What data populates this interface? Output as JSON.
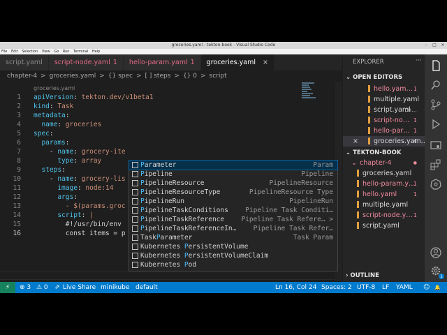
{
  "window": {
    "title": "groceries.yaml - tekton-book - Visual Studio Code"
  },
  "menu": [
    "File",
    "Edit",
    "Selection",
    "View",
    "Go",
    "Run",
    "Terminal",
    "Help"
  ],
  "tabs": [
    {
      "label": "script.yaml",
      "badge": "",
      "state": "normal"
    },
    {
      "label": "script-node.yaml",
      "badge": "1",
      "state": "dirty"
    },
    {
      "label": "hello-param.yaml",
      "badge": "1",
      "state": "dirty"
    },
    {
      "label": "groceries.yaml",
      "badge": "",
      "state": "active",
      "close": "×"
    }
  ],
  "breadcrumb": [
    "chapter-4",
    ">",
    "groceries.yaml",
    ">",
    "{} spec",
    ">",
    "[ ] steps",
    ">",
    "{} 0",
    ">",
    "script"
  ],
  "editor": {
    "header": "groceries.yaml",
    "lines": [
      {
        "n": "1",
        "key": "apiVersion",
        "sep": ": ",
        "val": "tekton.dev/v1beta1",
        "indent": ""
      },
      {
        "n": "2",
        "key": "kind",
        "sep": ": ",
        "val": "Task",
        "indent": ""
      },
      {
        "n": "3",
        "key": "metadata",
        "sep": ":",
        "val": "",
        "indent": ""
      },
      {
        "n": "4",
        "key": "name",
        "sep": ": ",
        "val": "groceries",
        "indent": "  "
      },
      {
        "n": "5",
        "key": "spec",
        "sep": ":",
        "val": "",
        "indent": ""
      },
      {
        "n": "6",
        "key": "params",
        "sep": ":",
        "val": "",
        "indent": "  "
      },
      {
        "n": "7",
        "key": "name",
        "sep": ": ",
        "val": "grocery-ite",
        "indent": "    - "
      },
      {
        "n": "8",
        "key": "type",
        "sep": ": ",
        "val": "array",
        "indent": "      "
      },
      {
        "n": "9",
        "key": "steps",
        "sep": ":",
        "val": "",
        "indent": "  "
      },
      {
        "n": "10",
        "key": "name",
        "sep": ": ",
        "val": "grocery-lis",
        "indent": "    - "
      },
      {
        "n": "11",
        "key": "image",
        "sep": ": ",
        "val": "node:14",
        "indent": "      "
      },
      {
        "n": "12",
        "key": "args",
        "sep": ":",
        "val": "",
        "indent": "      "
      },
      {
        "n": "13",
        "key": "",
        "sep": "",
        "val": "- $(params.groc",
        "indent": "        "
      },
      {
        "n": "14",
        "key": "script",
        "sep": ": ",
        "val": "|",
        "indent": "      "
      },
      {
        "n": "15",
        "key": "",
        "sep": "",
        "val": "#!/usr/bin/env",
        "indent": "        "
      },
      {
        "n": "16",
        "key": "",
        "sep": "",
        "val": "const items = p",
        "indent": "        "
      }
    ]
  },
  "suggestions": [
    {
      "pre": "",
      "match": "P",
      "rest": "arameter",
      "detail": "Param",
      "selected": true
    },
    {
      "pre": "",
      "match": "P",
      "rest": "ipeline",
      "detail": "Pipeline",
      "selected": false
    },
    {
      "pre": "",
      "match": "P",
      "rest": "ipelineResource",
      "detail": "PipelineResource",
      "selected": false
    },
    {
      "pre": "",
      "match": "P",
      "rest": "ipelineResourceType",
      "detail": "PipelineResource Type",
      "selected": false
    },
    {
      "pre": "",
      "match": "P",
      "rest": "ipelineRun",
      "detail": "PipelineRun",
      "selected": false
    },
    {
      "pre": "",
      "match": "P",
      "rest": "ipelineTaskConditions",
      "detail": "Pipeline Task Conditi…",
      "selected": false
    },
    {
      "pre": "",
      "match": "P",
      "rest": "ipelineTaskReference",
      "detail": "Pipeline Task Refere… >",
      "selected": false
    },
    {
      "pre": "",
      "match": "P",
      "rest": "ipelineTaskReferenceIn…",
      "detail": "Pipeline Task Refer…",
      "selected": false
    },
    {
      "pre": "Task",
      "match": "P",
      "rest": "arameter",
      "detail": "Task Param",
      "selected": false
    },
    {
      "pre": "Kubernetes ",
      "match": "P",
      "rest": "ersistentVolume",
      "detail": "",
      "selected": false
    },
    {
      "pre": "Kubernetes ",
      "match": "P",
      "rest": "ersistentVolumeClaim",
      "detail": "",
      "selected": false
    },
    {
      "pre": "Kubernetes ",
      "match": "P",
      "rest": "od",
      "detail": "",
      "selected": false
    }
  ],
  "sidebar": {
    "title": "EXPLORER",
    "more": "···",
    "open_editors_label": "OPEN EDITORS",
    "open_editors": [
      {
        "name": "hello.yam…",
        "count": "1",
        "color": "red"
      },
      {
        "name": "multiple.yaml",
        "count": "",
        "color": "white"
      },
      {
        "name": "script.yaml",
        "count": "ch…",
        "color": "white"
      },
      {
        "name": "script-no…",
        "count": "1",
        "color": "red"
      },
      {
        "name": "hello-par…",
        "count": "1",
        "color": "red"
      },
      {
        "name": "groceries.yam…",
        "count": "4",
        "color": "white",
        "close": "×"
      }
    ],
    "project_label": "TEKTON-BOOK",
    "folder": {
      "name": "chapter-4",
      "marker": "●"
    },
    "files": [
      {
        "name": "groceries.yaml",
        "count": "",
        "color": "white"
      },
      {
        "name": "hello-param.y…",
        "count": "1",
        "color": "red"
      },
      {
        "name": "hello.yaml",
        "count": "1",
        "color": "red"
      },
      {
        "name": "multiple.yaml",
        "count": "",
        "color": "white"
      },
      {
        "name": "script-node.y…",
        "count": "1",
        "color": "red"
      },
      {
        "name": "script.yaml",
        "count": "",
        "color": "white"
      }
    ],
    "outline_label": "OUTLINE"
  },
  "statusbar": {
    "remote": "⚡",
    "errors": "⊗ 3",
    "warnings": "⚠ 0",
    "live_share": "Live Share",
    "cluster": "minikube",
    "namespace": "default",
    "position": "Ln 16, Col 24",
    "spaces": "Spaces: 2",
    "encoding": "UTF-8",
    "eol": "LF",
    "language": "YAML",
    "feedback": "☺",
    "bell": "🔔"
  },
  "activity_icons": [
    "files-icon",
    "search-icon",
    "source-control-icon",
    "run-icon",
    "remote-explorer-icon",
    "extensions-icon",
    "kubernetes-icon",
    "account-icon",
    "settings-icon"
  ]
}
